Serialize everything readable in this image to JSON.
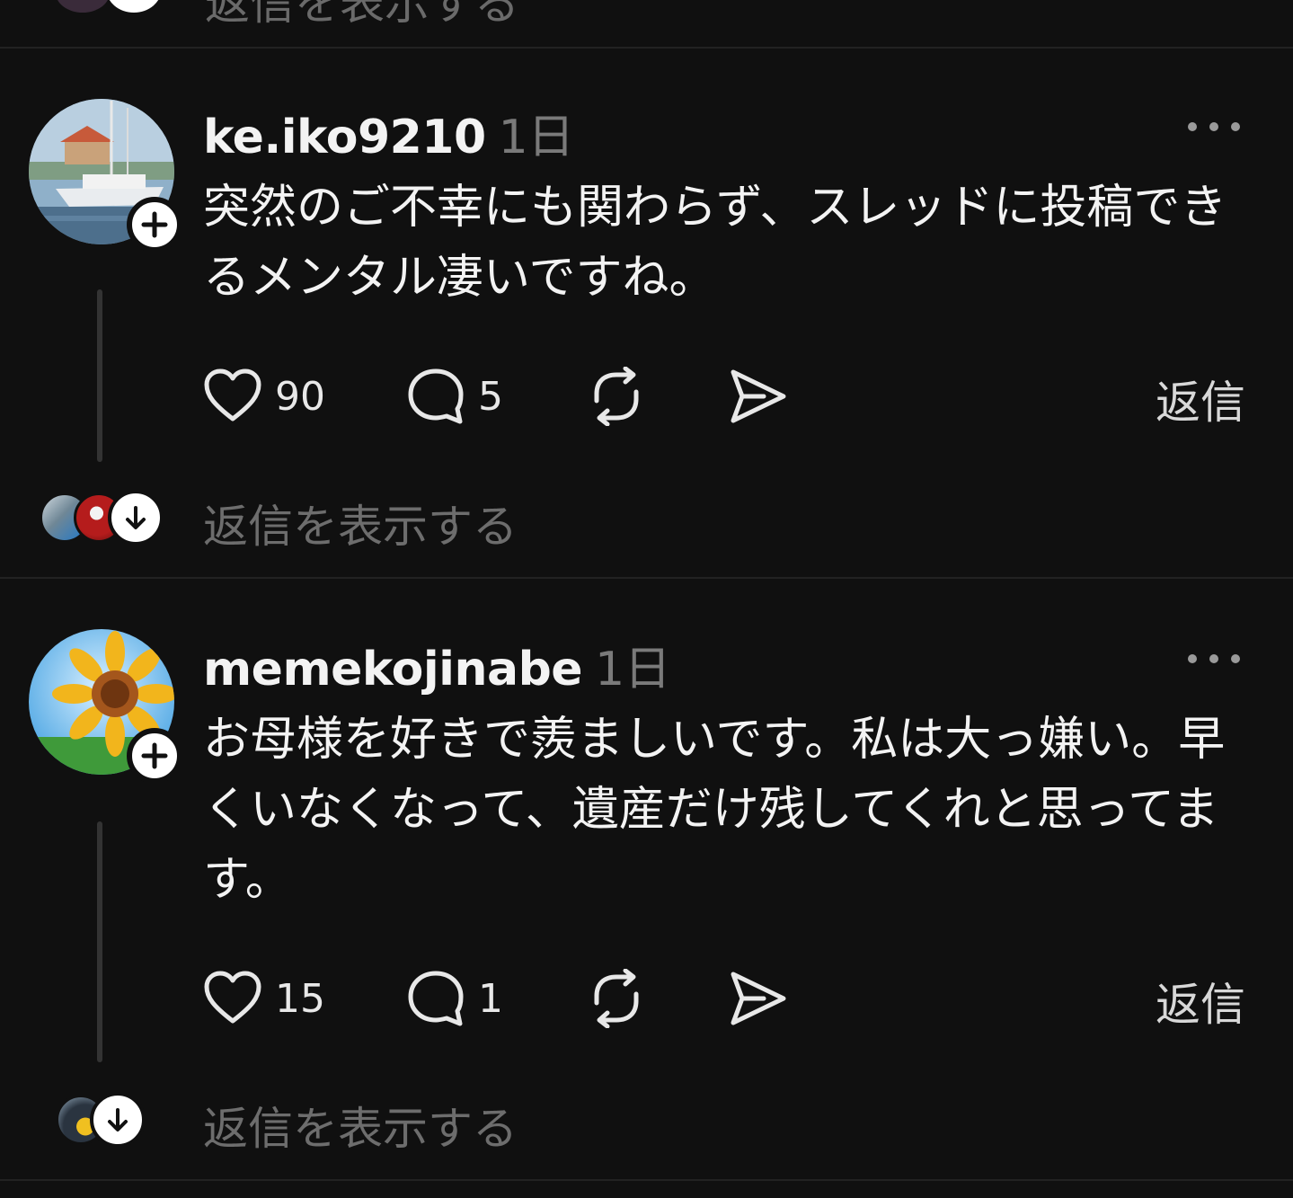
{
  "top": {
    "show_replies_label": "返信を表示する"
  },
  "posts": [
    {
      "username": "ke.iko9210",
      "time": "1日",
      "text": "突然のご不幸にも関わらず、スレッドに投稿できるメンタル凄いですね。",
      "likes": "90",
      "comments": "5",
      "reply_label": "返信",
      "show_replies_label": "返信を表示する"
    },
    {
      "username": "memekojinabe",
      "time": "1日",
      "text": "お母様を好きで羨ましいです。私は大っ嫌い。早くいなくなって、遺産だけ残してくれと思ってます。",
      "likes": "15",
      "comments": "1",
      "reply_label": "返信",
      "show_replies_label": "返信を表示する"
    }
  ],
  "icons": [
    "more-icon",
    "heart-icon",
    "comment-icon",
    "repost-icon",
    "share-icon",
    "plus-icon",
    "arrow-down-icon"
  ],
  "colors": {
    "background": "#101010",
    "text": "#f3f3f3",
    "muted": "#7a7a7a",
    "divider": "#222222"
  }
}
